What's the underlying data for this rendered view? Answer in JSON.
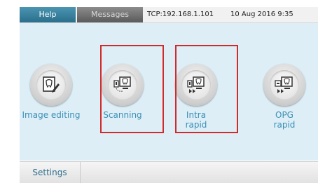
{
  "header": {
    "help_tab": "Help",
    "messages_tab": "Messages",
    "connection": "TCP:192.168.1.101",
    "datetime": "10 Aug 2016 9:35"
  },
  "apps": [
    {
      "label": "Image editing",
      "icon": "tooth-pencil-icon"
    },
    {
      "label": "Scanning",
      "icon": "tooth-scanner-icon"
    },
    {
      "label_line1": "Intra",
      "label_line2": "rapid",
      "icon": "tooth-intra-rapid-icon"
    },
    {
      "label_line1": "OPG",
      "label_line2": "rapid",
      "icon": "tooth-opg-rapid-icon"
    }
  ],
  "footer": {
    "settings_label": "Settings"
  },
  "colors": {
    "accent": "#3a8fb5",
    "highlight": "#d22a2a",
    "background": "#ddeef6"
  }
}
